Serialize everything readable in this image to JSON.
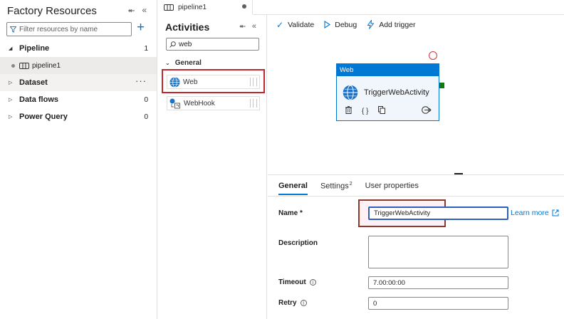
{
  "left_panel": {
    "title": "Factory Resources",
    "filter_placeholder": "Filter resources by name",
    "tree": [
      {
        "label": "Pipeline",
        "count": "1"
      },
      {
        "label": "Dataset",
        "count": ""
      },
      {
        "label": "Data flows",
        "count": "0"
      },
      {
        "label": "Power Query",
        "count": "0"
      }
    ],
    "pipeline_item": "pipeline1",
    "more_label": "···"
  },
  "tab": {
    "label": "pipeline1"
  },
  "activities": {
    "title": "Activities",
    "search_value": "web",
    "group": "General",
    "items": [
      {
        "label": "Web",
        "icon": "globe-icon"
      },
      {
        "label": "WebHook",
        "icon": "webhook-icon"
      }
    ]
  },
  "toolbar": {
    "validate": "Validate",
    "debug": "Debug",
    "add_trigger": "Add trigger"
  },
  "node": {
    "header": "Web",
    "name": "TriggerWebActivity"
  },
  "properties": {
    "tabs": [
      {
        "label": "General",
        "badge": ""
      },
      {
        "label": "Settings",
        "badge": "2"
      },
      {
        "label": "User properties",
        "badge": ""
      }
    ],
    "name_label": "Name *",
    "name_value": "TriggerWebActivity",
    "learn_more": "Learn more",
    "description_label": "Description",
    "description_value": "",
    "timeout_label": "Timeout",
    "timeout_value": "7.00:00:00",
    "retry_label": "Retry",
    "retry_value": "0"
  },
  "colors": {
    "accent": "#0078d4",
    "highlight_red": "#c4262e",
    "highlight_brown": "#8b3a2e",
    "success": "#107c10",
    "failure": "#d13438"
  }
}
